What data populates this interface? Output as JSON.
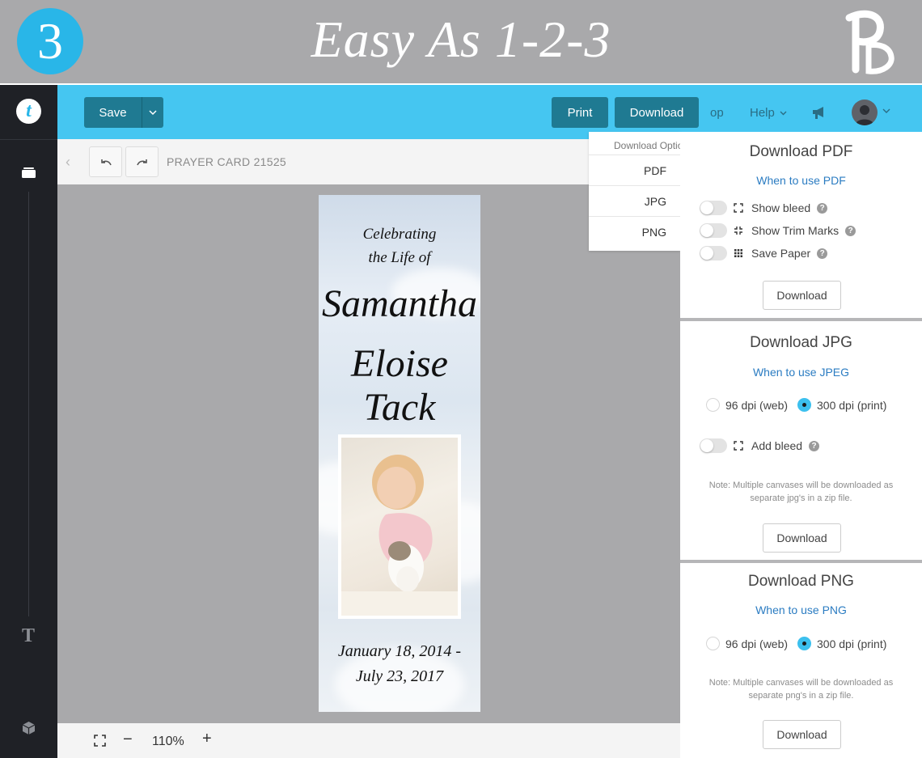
{
  "banner": {
    "step_number": "3",
    "title": "Easy As 1-2-3"
  },
  "sidebar": {
    "logo_letter": "t",
    "text_tool": "T"
  },
  "toolbar": {
    "save_label": "Save",
    "print_label": "Print",
    "download_label": "Download",
    "partial_text": "op",
    "help_label": "Help"
  },
  "document": {
    "title": "PRAYER CARD 21525"
  },
  "card": {
    "line1": "Celebrating",
    "line2": "the Life of",
    "first_name": "Samantha",
    "middle_name": "Eloise",
    "last_name": "Tack",
    "dates_line1": "January 18, 2014 -",
    "dates_line2": "July 23, 2017"
  },
  "bottom_bar": {
    "zoom": "110%"
  },
  "download_menu": {
    "header": "Download Options",
    "items": [
      "PDF",
      "JPG",
      "PNG"
    ]
  },
  "pdf_panel": {
    "title": "Download PDF",
    "link": "When to use PDF",
    "options": [
      "Show bleed",
      "Show Trim Marks",
      "Save Paper"
    ],
    "button": "Download"
  },
  "jpg_panel": {
    "title": "Download JPG",
    "link": "When to use JPEG",
    "dpi_options": [
      "96 dpi (web)",
      "300 dpi (print)"
    ],
    "selected_dpi": "300 dpi (print)",
    "bleed_label": "Add bleed",
    "note": "Note: Multiple canvases will be downloaded as separate jpg's in a zip file.",
    "button": "Download"
  },
  "png_panel": {
    "title": "Download PNG",
    "link": "When to use PNG",
    "dpi_options": [
      "96 dpi (web)",
      "300 dpi (print)"
    ],
    "selected_dpi": "300 dpi (print)",
    "note": "Note: Multiple canvases will be downloaded as separate png's in a zip file.",
    "button": "Download"
  },
  "colors": {
    "accent": "#45c6f1",
    "button_dark": "#1f7a92",
    "sidebar": "#1f2126",
    "link": "#2b7cc2"
  }
}
